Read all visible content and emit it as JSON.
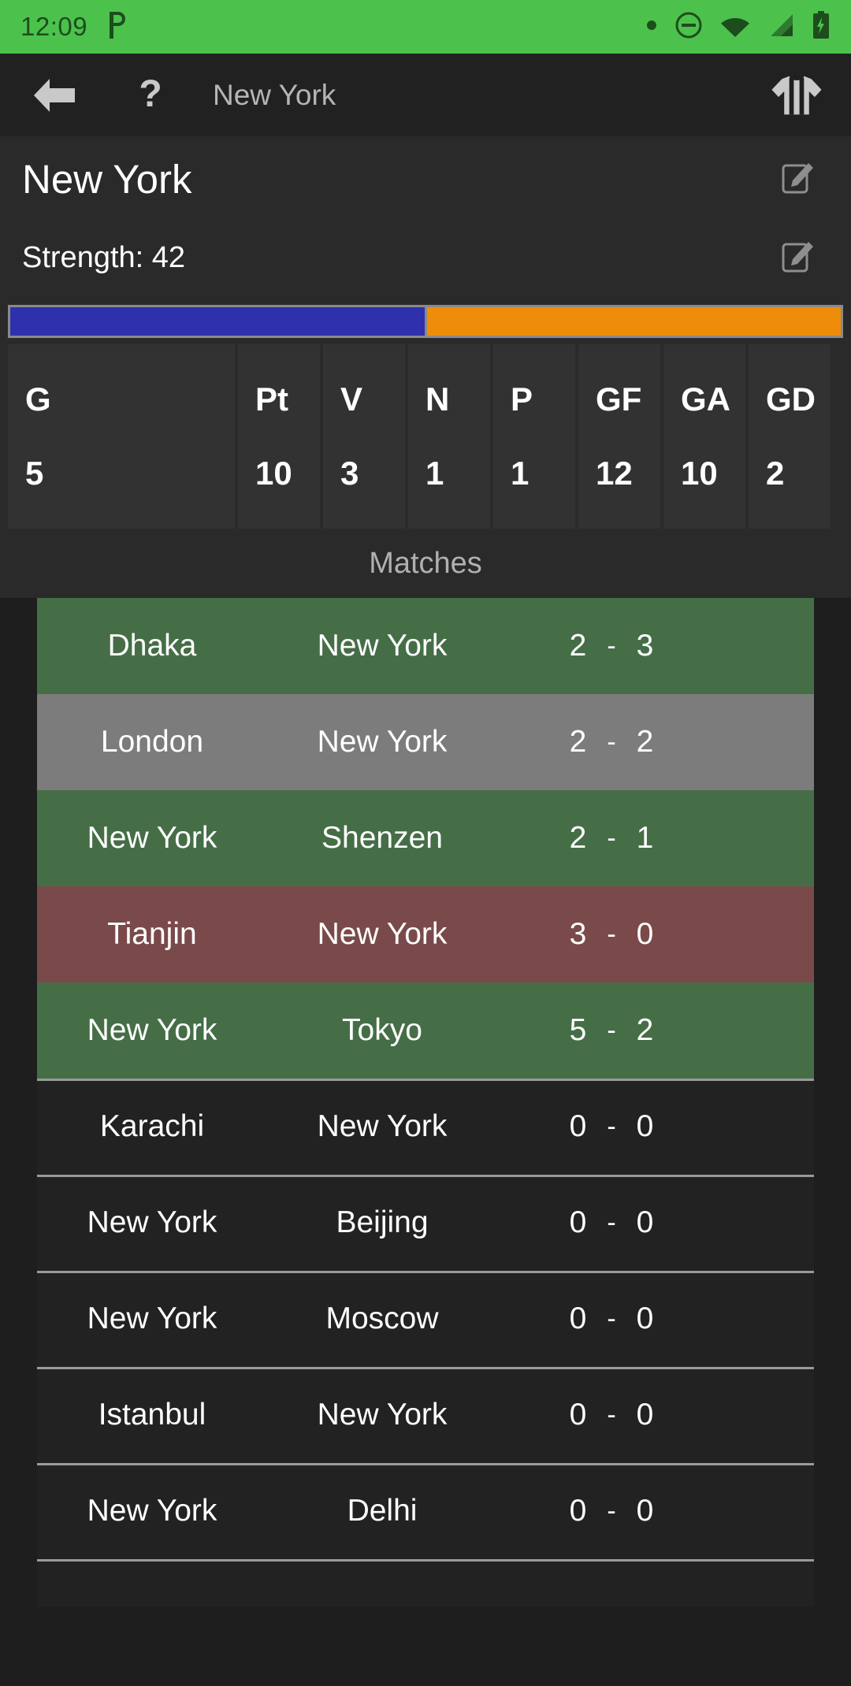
{
  "status_bar": {
    "time": "12:09",
    "app_badge_icon": "pocketcasts-p-icon",
    "icons": [
      "dot-icon",
      "do-not-disturb-icon",
      "wifi-icon",
      "cellular-signal-icon",
      "battery-charging-icon"
    ],
    "background_color": "#4CC24C",
    "foreground_color": "#1d4d1d"
  },
  "app_bar": {
    "back_icon": "back-arrow-icon",
    "help_icon": "question-mark-icon",
    "title": "New York",
    "jersey_icon": "striped-jersey-icon"
  },
  "header": {
    "team_name": "New York",
    "team_edit_icon": "edit-pencil-icon",
    "strength_label": "Strength: 42",
    "strength_edit_icon": "edit-pencil-icon",
    "kit_colors": {
      "primary": "#2e31ab",
      "secondary": "#ef8c0a",
      "border": "#8a8a8a",
      "primary_pct": 50,
      "secondary_pct": 50
    }
  },
  "stats": {
    "columns": [
      {
        "header": "G",
        "value": "5",
        "width": "wide"
      },
      {
        "header": "Pt",
        "value": "10",
        "width": "narrow"
      },
      {
        "header": "V",
        "value": "3",
        "width": "narrow"
      },
      {
        "header": "N",
        "value": "1",
        "width": "narrow"
      },
      {
        "header": "P",
        "value": "1",
        "width": "narrow"
      },
      {
        "header": "GF",
        "value": "12",
        "width": "narrow"
      },
      {
        "header": "GA",
        "value": "10",
        "width": "narrow"
      },
      {
        "header": "GD",
        "value": "2",
        "width": "narrow"
      }
    ]
  },
  "matches_section": {
    "label": "Matches",
    "score_separator": "-",
    "result_colors": {
      "win": "#456e47",
      "draw": "#7c7c7c",
      "loss": "#7a4a4a",
      "unplayed": "#222222"
    },
    "matches": [
      {
        "home": "Dhaka",
        "away": "New York",
        "home_score": "2",
        "away_score": "3",
        "result": "win"
      },
      {
        "home": "London",
        "away": "New York",
        "home_score": "2",
        "away_score": "2",
        "result": "draw"
      },
      {
        "home": "New York",
        "away": "Shenzen",
        "home_score": "2",
        "away_score": "1",
        "result": "win"
      },
      {
        "home": "Tianjin",
        "away": "New York",
        "home_score": "3",
        "away_score": "0",
        "result": "loss"
      },
      {
        "home": "New York",
        "away": "Tokyo",
        "home_score": "5",
        "away_score": "2",
        "result": "win"
      },
      {
        "home": "Karachi",
        "away": "New York",
        "home_score": "0",
        "away_score": "0",
        "result": "none"
      },
      {
        "home": "New York",
        "away": "Beijing",
        "home_score": "0",
        "away_score": "0",
        "result": "none"
      },
      {
        "home": "New York",
        "away": "Moscow",
        "home_score": "0",
        "away_score": "0",
        "result": "none"
      },
      {
        "home": "Istanbul",
        "away": "New York",
        "home_score": "0",
        "away_score": "0",
        "result": "none"
      },
      {
        "home": "New York",
        "away": "Delhi",
        "home_score": "0",
        "away_score": "0",
        "result": "none"
      }
    ]
  }
}
